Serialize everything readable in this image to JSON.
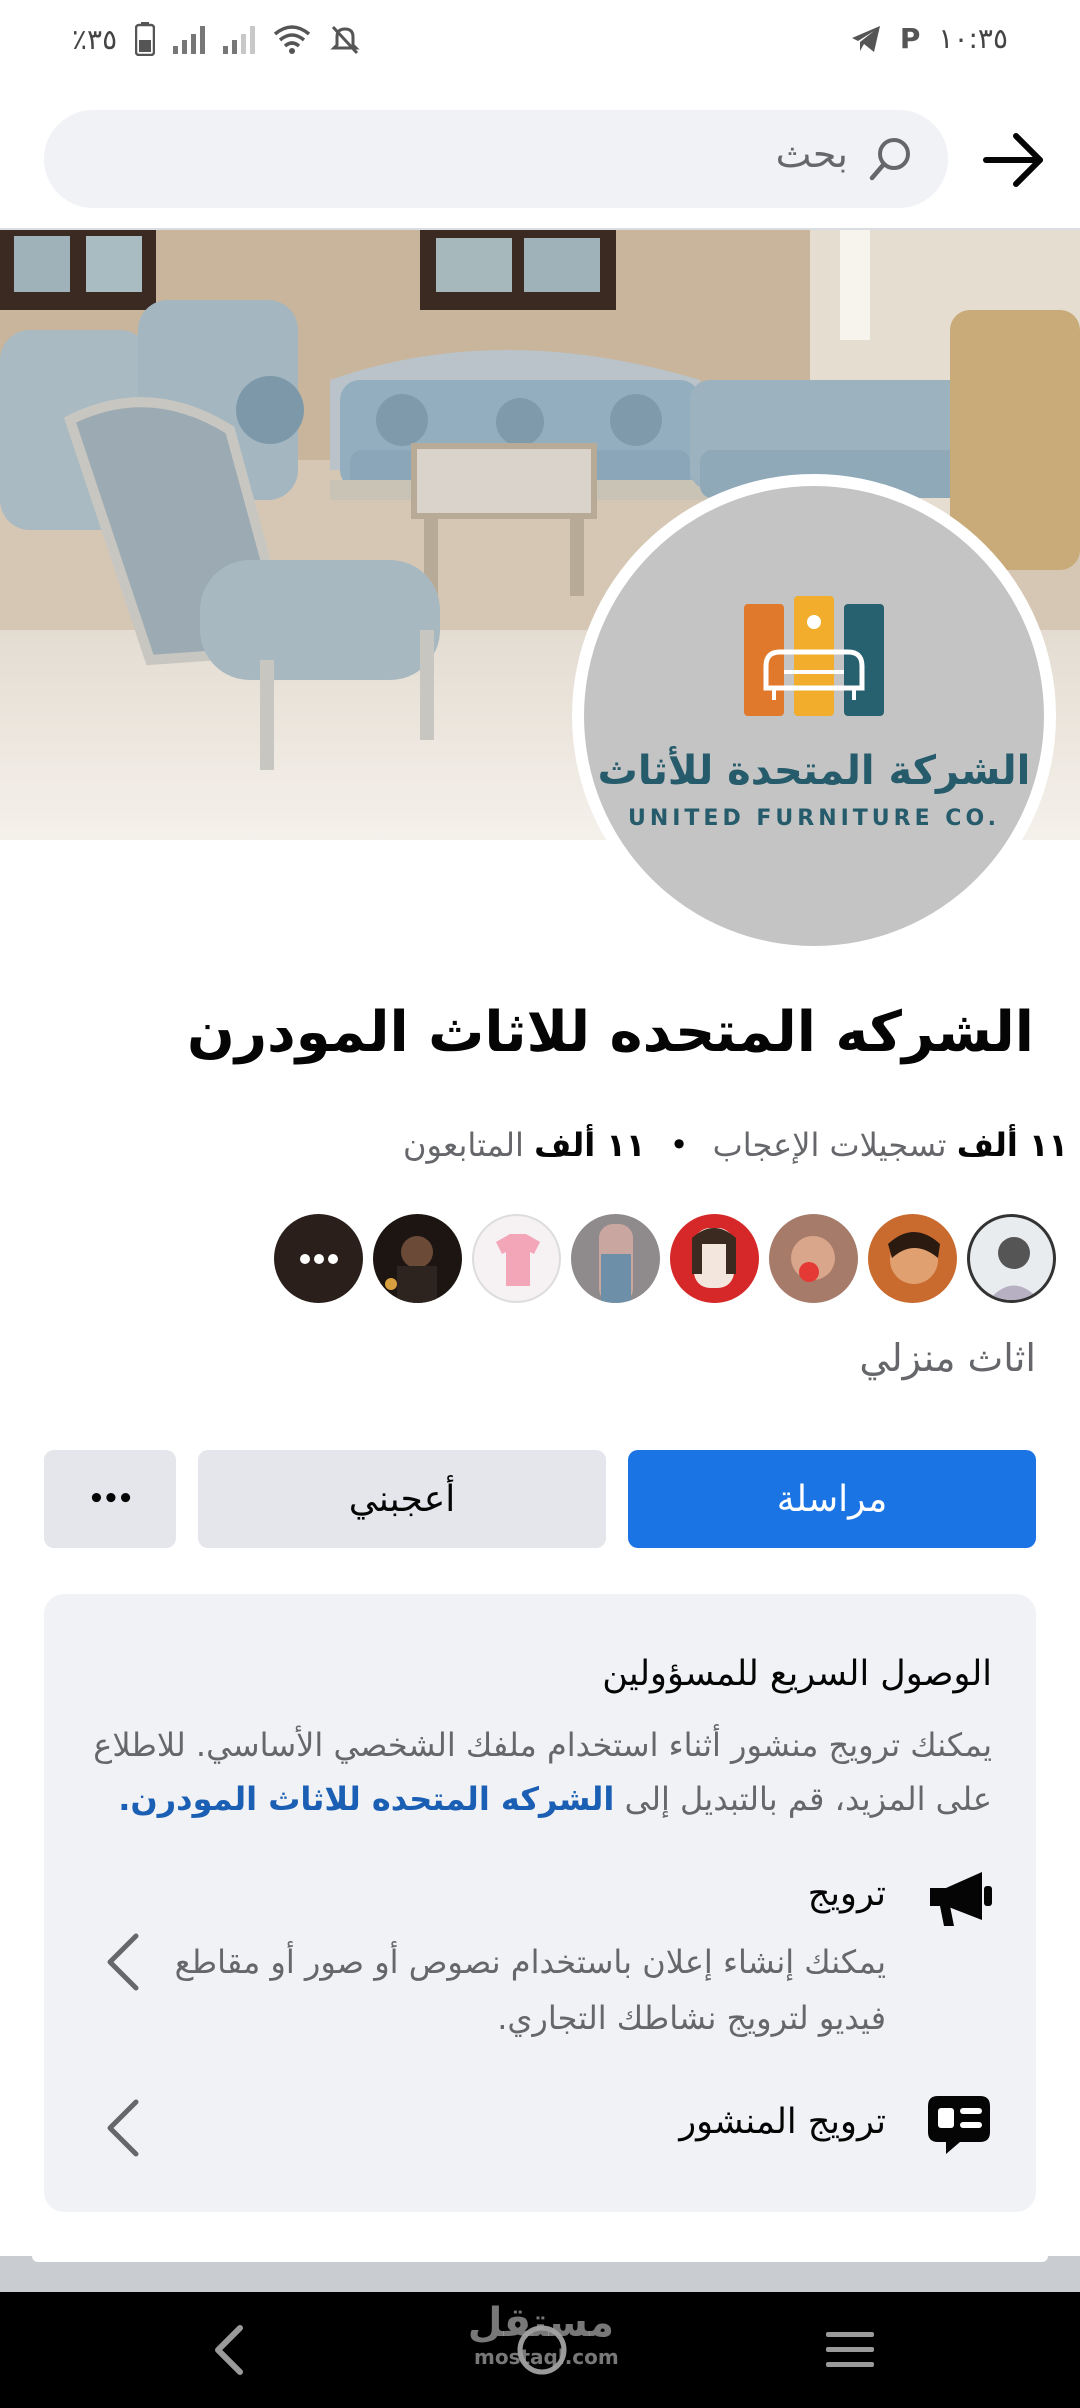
{
  "status_bar": {
    "time": "١٠:٣٥",
    "battery": "٪٣٥",
    "carrier_glyph": "P"
  },
  "search": {
    "placeholder": "بحث"
  },
  "profile": {
    "logo_text_ar": "الشركة المتحدة للأثاث",
    "logo_text_en": "UNITED FURNITURE CO.",
    "logo_colors": [
      "#e0792c",
      "#f2ad2c",
      "#27616f"
    ],
    "page_name": "الشركه المتحده للاثاث المودرن",
    "likes_count": "١١ ألف",
    "likes_label": "تسجيلات الإعجاب",
    "separator": "•",
    "followers_count": "١١ ألف",
    "followers_label": "المتابعون",
    "category": "اثاث منزلي"
  },
  "actions": {
    "message_label": "مراسلة",
    "like_label": "أعجبني",
    "more_label": "•••"
  },
  "admin_card": {
    "title": "الوصول السريع للمسؤولين",
    "body_text": "يمكنك ترويج منشور أثناء استخدام ملفك الشخصي الأساسي. للاطلاع على المزيد، قم بالتبديل إلى",
    "body_link": "الشركه المتحده للاثاث المودرن",
    "body_end": ".",
    "items": [
      {
        "title": "ترويج",
        "description": "يمكنك إنشاء إعلان باستخدام نصوص أو صور أو مقاطع فيديو لترويج نشاطك التجاري.",
        "icon": "megaphone-icon"
      },
      {
        "title": "ترويج المنشور",
        "description": "",
        "icon": "chat-bubble-icon"
      }
    ]
  },
  "watermark": {
    "text_ar": "مستقل",
    "text_en": "mostaql.com"
  },
  "colors": {
    "primary_button": "#1b74e4",
    "secondary_button": "#e4e6eb",
    "card_background": "#f0f2f5",
    "link": "#1a5fb4"
  }
}
